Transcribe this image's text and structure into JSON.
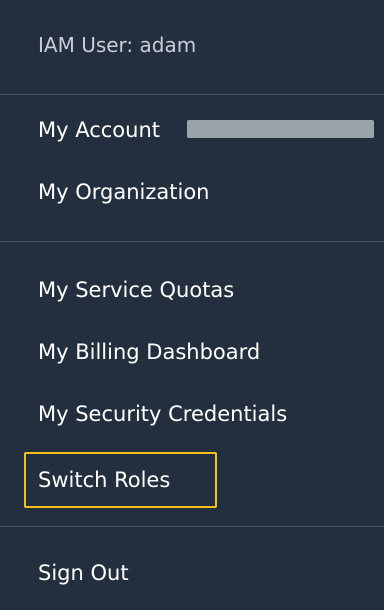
{
  "menu": {
    "header": "IAM User: adam",
    "items": [
      {
        "label": "My Account"
      },
      {
        "label": "My Organization"
      },
      {
        "label": "My Service Quotas"
      },
      {
        "label": "My Billing Dashboard"
      },
      {
        "label": "My Security Credentials"
      },
      {
        "label": "Switch Roles"
      },
      {
        "label": "Sign Out"
      }
    ]
  },
  "colors": {
    "background": "#232f3e",
    "highlight_border": "#f2c21b",
    "divider": "#48566a"
  }
}
